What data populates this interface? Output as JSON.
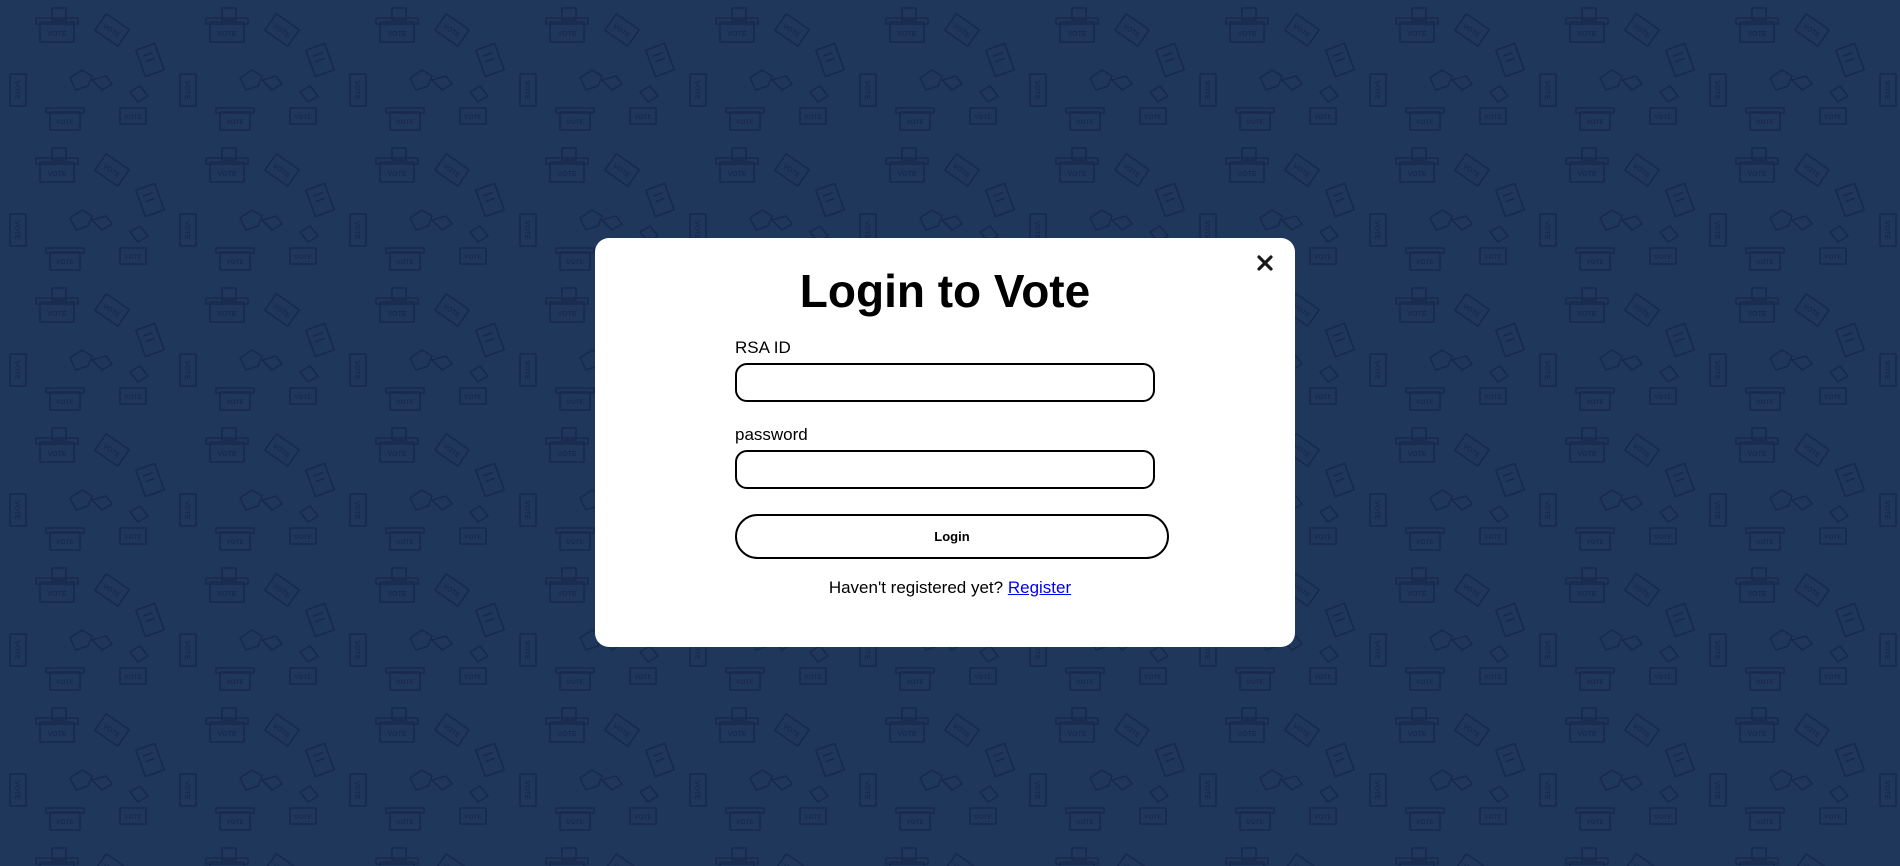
{
  "theme": {
    "background": "#20375c",
    "pattern_stroke": "#15264a",
    "modal_background": "#ffffff",
    "link_color": "#0000ee"
  },
  "background": {
    "pattern_icons": [
      "ballot-box-icon",
      "ballot-paper-icon",
      "hand-icon"
    ],
    "pattern_text": "VOTE"
  },
  "modal": {
    "title": "Login to Vote",
    "close_icon": "close-icon",
    "fields": {
      "rsa_id": {
        "label": "RSA ID",
        "value": "",
        "placeholder": ""
      },
      "password": {
        "label": "password",
        "value": "",
        "placeholder": ""
      }
    },
    "login_button": "Login",
    "register_prompt": "Haven't registered yet?",
    "register_link": "Register"
  }
}
